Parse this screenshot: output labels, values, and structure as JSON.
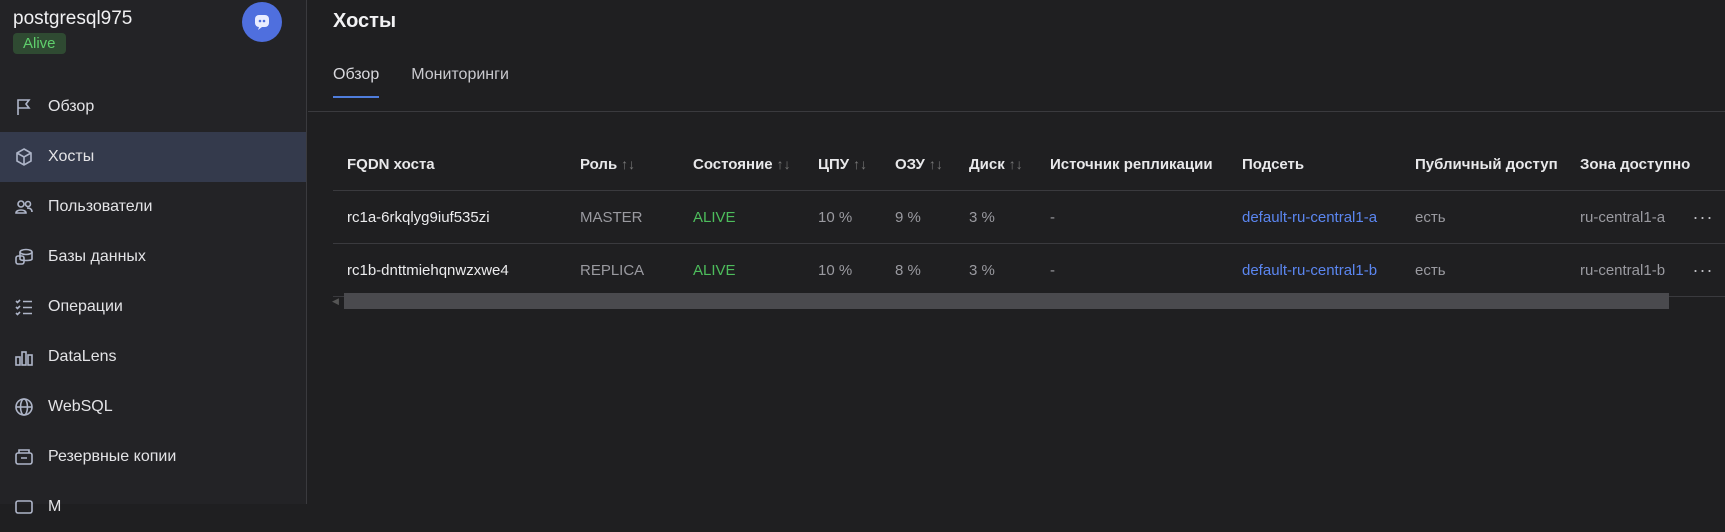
{
  "sidebar": {
    "cluster_name": "postgresql975",
    "status": "Alive",
    "items": [
      {
        "label": "Обзор",
        "icon": "flag-icon"
      },
      {
        "label": "Хосты",
        "icon": "cube-icon"
      },
      {
        "label": "Пользователи",
        "icon": "users-icon"
      },
      {
        "label": "Базы данных",
        "icon": "databases-icon"
      },
      {
        "label": "Операции",
        "icon": "checklist-icon"
      },
      {
        "label": "DataLens",
        "icon": "chart-icon"
      },
      {
        "label": "WebSQL",
        "icon": "globe-icon"
      },
      {
        "label": "Резервные копии",
        "icon": "backup-icon"
      },
      {
        "label": "М",
        "icon": "other-icon"
      }
    ],
    "active_index": 1
  },
  "header": {
    "title": "Хосты"
  },
  "tabs": [
    {
      "label": "Обзор",
      "active": true
    },
    {
      "label": "Мониторинги",
      "active": false
    }
  ],
  "table": {
    "columns": {
      "fqdn": "FQDN хоста",
      "role": "Роль",
      "state": "Состояние",
      "cpu": "ЦПУ",
      "ram": "ОЗУ",
      "disk": "Диск",
      "replication_source": "Источник репликации",
      "subnet": "Подсеть",
      "public_access": "Публичный доступ",
      "zone": "Зона доступно"
    },
    "sort_glyph": "↑↓",
    "rows": [
      {
        "fqdn": "rc1a-6rkqlyg9iuf535zi",
        "role": "MASTER",
        "state": "ALIVE",
        "cpu": "10 %",
        "ram": "9 %",
        "disk": "3 %",
        "replication_source": "-",
        "subnet": "default-ru-central1-a",
        "public_access": "есть",
        "zone": "ru-central1-a",
        "more": "···"
      },
      {
        "fqdn": "rc1b-dnttmiehqnwzxwe4",
        "role": "REPLICA",
        "state": "ALIVE",
        "cpu": "10 %",
        "ram": "8 %",
        "disk": "3 %",
        "replication_source": "-",
        "subnet": "default-ru-central1-b",
        "public_access": "есть",
        "zone": "ru-central1-b",
        "more": "···"
      }
    ]
  },
  "colors": {
    "background": "#1f1f21",
    "sidebar": "#232326",
    "active_item": "#343a4c",
    "accent": "#4f7ddc",
    "alive": "#4dbd5c",
    "link": "#5b86f0"
  }
}
